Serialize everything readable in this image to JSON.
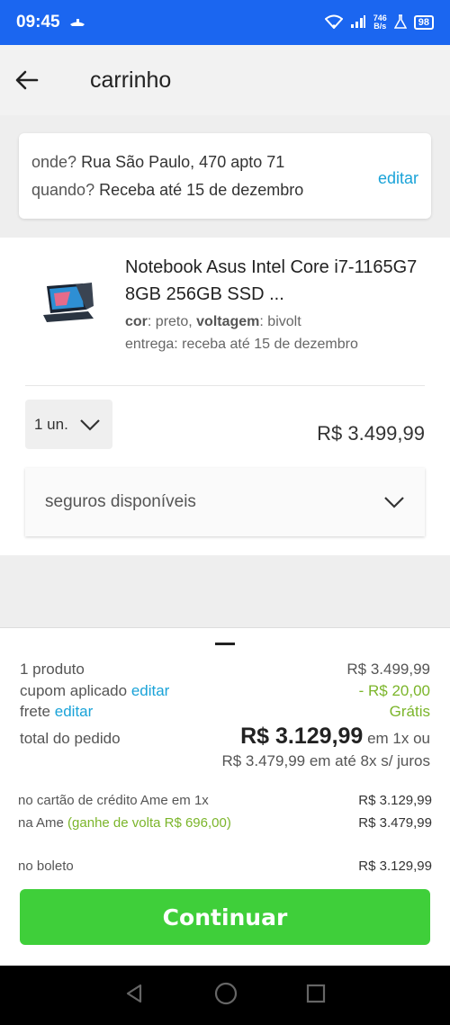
{
  "status_bar": {
    "time": "09:45",
    "net_speed_top": "746",
    "net_speed_bottom": "B/s",
    "battery": "98"
  },
  "header": {
    "title": "carrinho"
  },
  "delivery": {
    "where_label": "onde?",
    "where_value": "Rua São Paulo, 470 apto 71",
    "when_label": "quando?",
    "when_value": "Receba até 15 de dezembro",
    "edit_label": "editar"
  },
  "product": {
    "name": "Notebook Asus Intel Core i7-1165G7 8GB 256GB SSD ...",
    "color_label": "cor",
    "color_value": "preto",
    "voltage_label": "voltagem",
    "voltage_value": "bivolt",
    "delivery": "entrega: receba até 15 de dezembro",
    "quantity": "1 un.",
    "price": "R$ 3.499,99",
    "insurance_label": "seguros disponíveis"
  },
  "summary": {
    "products_label": "1 produto",
    "products_value": "R$ 3.499,99",
    "coupon_label": "cupom aplicado",
    "coupon_edit": "editar",
    "coupon_value": "- R$ 20,00",
    "shipping_label": "frete",
    "shipping_edit": "editar",
    "shipping_value": "Grátis",
    "total_label": "total do pedido",
    "total_value": "R$ 3.129,99",
    "total_suffix": "em 1x ou",
    "installments": "R$ 3.479,99 em até 8x s/ juros"
  },
  "payment_options": [
    {
      "label": "no cartão de crédito Ame em 1x",
      "extra": "",
      "amount": "R$ 3.129,99"
    },
    {
      "label": "na Ame",
      "extra": "(ganhe de volta R$ 696,00)",
      "amount": "R$ 3.479,99"
    },
    {
      "label": "no boleto",
      "extra": "",
      "amount": "R$ 3.129,99"
    }
  ],
  "continue_label": "Continuar",
  "colors": {
    "status_bar": "#1b66f0",
    "link": "#1aa3d8",
    "green": "#7bb52a",
    "button": "#3fcf3a"
  }
}
